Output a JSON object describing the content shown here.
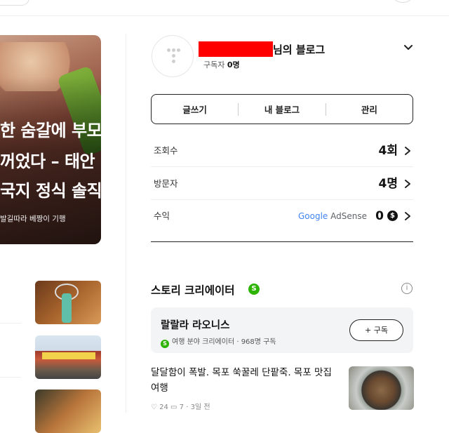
{
  "hero": {
    "line1": "한 숨갈에 부모",
    "line2": "꺼었다 – 태안",
    "line3": "국지 정식 솔직",
    "source": "발길따라 베짱이 기행"
  },
  "blog": {
    "name_suffix": "님의 블로그",
    "subscribers_label": "구독자",
    "subscribers_value": "0명"
  },
  "actions": {
    "write": "글쓰기",
    "my_blog": "내 블로그",
    "manage": "관리"
  },
  "stats": {
    "views_label": "조회수",
    "views_value": "4회",
    "visitors_label": "방문자",
    "visitors_value": "4명",
    "revenue_label": "수익",
    "adsense_google": "Google",
    "adsense_label": "AdSense",
    "revenue_value": "0",
    "currency_symbol": "$"
  },
  "story_creator": {
    "title": "스토리 크리에이터",
    "badge": "S",
    "info": "i",
    "creator_name": "랄랄라 라오니스",
    "creator_badge": "S",
    "creator_meta": "여행 분야 크리에이터 · 968명 구독",
    "subscribe_label": "+ 구독",
    "post_title": "달달함이 폭발. 목포 쑥꿀레 단팥죽. 목포 맛집 여행",
    "post_meta": "♡ 24   ▭ 7 · 3일 전"
  },
  "colors": {
    "accent_green": "#2db400",
    "redaction": "#ff0000"
  }
}
